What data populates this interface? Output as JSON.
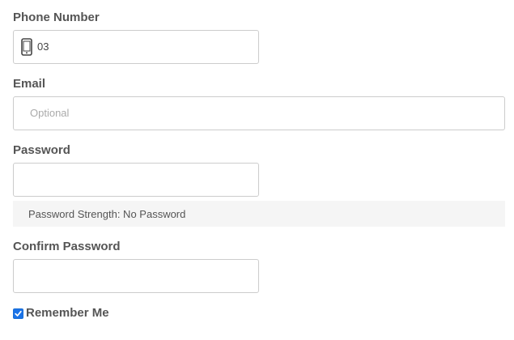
{
  "phone": {
    "label": "Phone Number",
    "value": "03",
    "icon": "mobile-phone-icon"
  },
  "email": {
    "label": "Email",
    "placeholder": "Optional",
    "value": ""
  },
  "password": {
    "label": "Password",
    "value": "",
    "strength_text": "Password Strength: No Password"
  },
  "confirm_password": {
    "label": "Confirm Password",
    "value": ""
  },
  "remember_me": {
    "label": "Remember Me",
    "checked": true
  },
  "colors": {
    "checkbox_accent": "#1a73e8",
    "label_text": "#555555",
    "input_border": "#cccccc",
    "strength_background": "#f5f5f5"
  }
}
